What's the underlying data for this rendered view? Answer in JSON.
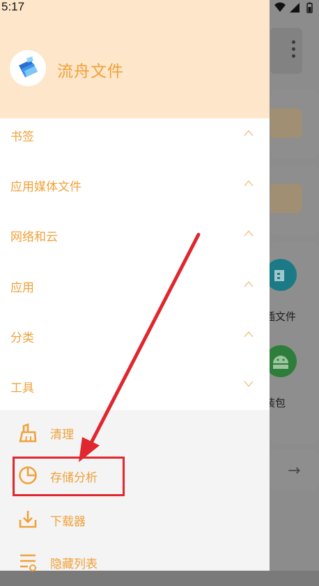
{
  "status_bar": {
    "time": "5:17"
  },
  "drawer": {
    "app_name": "流舟文件",
    "sections": [
      {
        "label": "书签",
        "expanded": false
      },
      {
        "label": "应用媒体文件",
        "expanded": false
      },
      {
        "label": "网络和云",
        "expanded": false
      },
      {
        "label": "应用",
        "expanded": false
      },
      {
        "label": "分类",
        "expanded": false
      },
      {
        "label": "工具",
        "expanded": true
      }
    ],
    "tools": [
      {
        "label": "清理",
        "icon": "broom-icon"
      },
      {
        "label": "存储分析",
        "icon": "pie-chart-icon"
      },
      {
        "label": "下载器",
        "icon": "download-icon"
      },
      {
        "label": "隐藏列表",
        "icon": "hidden-list-icon"
      }
    ]
  },
  "background": {
    "labels": [
      "插文件",
      "装包"
    ]
  },
  "colors": {
    "accent": "#f0a13a",
    "header_bg": "#fde6c9",
    "highlight": "#e0262e",
    "tools_bg": "#f4f4f4"
  }
}
